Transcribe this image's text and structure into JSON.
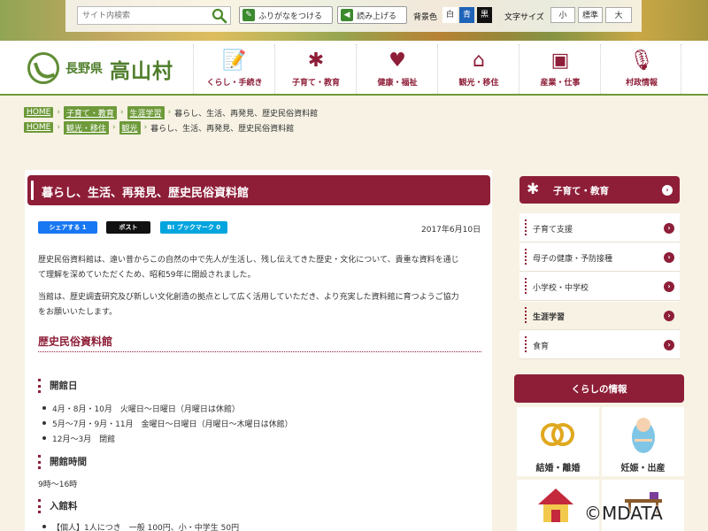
{
  "toolbar": {
    "search_placeholder": "サイト内検索",
    "furigana": "ふりがなをつける",
    "readaloud": "読み上げる",
    "bg_label": "背景色",
    "bg_white": "白",
    "bg_blue": "青",
    "bg_black": "黒",
    "fontsize_label": "文字サイズ",
    "size_small": "小",
    "size_normal": "標準",
    "size_large": "大"
  },
  "logo": {
    "prefecture": "長野県",
    "village": "高山村"
  },
  "nav": [
    {
      "label": "くらし・手続き",
      "icon": "document-pen-icon"
    },
    {
      "label": "子育て・教育",
      "icon": "child-icon"
    },
    {
      "label": "健康・福祉",
      "icon": "heart-hand-icon"
    },
    {
      "label": "観光・移住",
      "icon": "house-icon"
    },
    {
      "label": "産業・仕事",
      "icon": "briefcase-icon"
    },
    {
      "label": "村政情報",
      "icon": "microphone-icon"
    }
  ],
  "breadcrumbs": [
    {
      "items": [
        "HOME",
        "子育て・教育",
        "生涯学習"
      ],
      "current": "暮らし、生活、再発見、歴史民俗資料館"
    },
    {
      "items": [
        "HOME",
        "観光・移住",
        "観光"
      ],
      "current": "暮らし、生活、再発見、歴史民俗資料館"
    }
  ],
  "article": {
    "title": "暮らし、生活、再発見、歴史民俗資料館",
    "share": {
      "facebook": "シェアする 1",
      "x": "ポスト",
      "hatena": "B! ブックマーク 0"
    },
    "date": "2017年6月10日",
    "para1_line1": "歴史民俗資料館は、遠い昔からこの自然の中で先人が生活し、残し伝えてきた歴史・文化について、貴重な資料を通じ",
    "para1_line2": "て理解を深めていただくため、昭和59年に開設されました。",
    "para2_line1": "当館は、歴史調査研究及び新しい文化創造の拠点として広く活用していただき、より充実した資料館に育つようご協力",
    "para2_line2": "をお願いいたします。",
    "h2": "歴史民俗資料館",
    "open_days_heading": "開館日",
    "open_days": [
      "4月・8月・10月　火曜日～日曜日（月曜日は休館）",
      "5月～7月・9月・11月　金曜日～日曜日（月曜日～木曜日は休館）",
      "12月～3月　閉館"
    ],
    "hours_heading": "開館時間",
    "hours": "9時～16時",
    "fee_heading": "入館料",
    "fee_item": "【個人】1人につき　一般 100円、小・中学生 50円"
  },
  "sidebar": {
    "heading": "子育て・教育",
    "items": [
      {
        "label": "子育て支援",
        "active": false
      },
      {
        "label": "母子の健康・予防接種",
        "active": false
      },
      {
        "label": "小学校・中学校",
        "active": false
      },
      {
        "label": "生涯学習",
        "active": true
      },
      {
        "label": "食育",
        "active": false
      }
    ],
    "kurashi_heading": "くらしの情報",
    "tiles": [
      {
        "label": "結婚・離婚",
        "icon": "rings-icon"
      },
      {
        "label": "妊娠・出産",
        "icon": "baby-icon"
      }
    ]
  },
  "watermark": "©MDATA",
  "colors": {
    "accent": "#8e1e38",
    "green": "#6e9a3a",
    "background": "#f7f2e4"
  }
}
